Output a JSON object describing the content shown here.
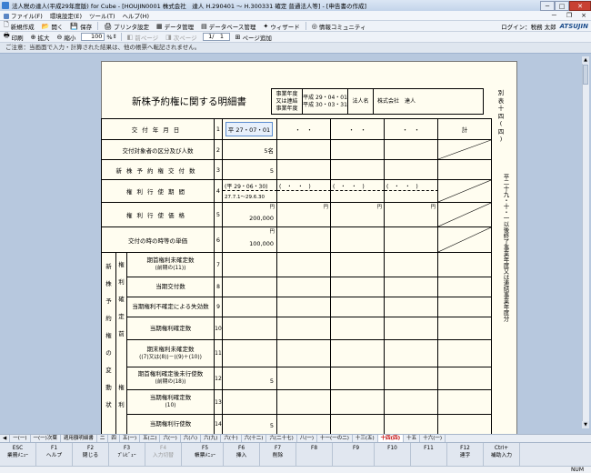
{
  "window": {
    "title": "法人税の達人(平成29年度版) for Cube - [HOUJIN0001 株式会社　達人 H.290401 ～ H.300331 確定 普通法人等] - [申告書の作成]",
    "min_label": "─",
    "max_label": "□",
    "close_label": "✕"
  },
  "menu": {
    "items": [
      "ファイル(F)",
      "環境設定(E)",
      "ツール(T)",
      "ヘルプ(H)"
    ],
    "sub_min": "－",
    "sub_restore": "❐",
    "sub_close": "×"
  },
  "toolbar1": {
    "new": "新規作成",
    "open": "開く",
    "save": "保存",
    "printer": "プリンタ設定",
    "data": "データ管理",
    "db": "データベース管理",
    "wizard": "ウィザード",
    "community": "情報コミュニティ",
    "login": "ログイン：税務 太郎",
    "logo": "ATSUJIN"
  },
  "toolbar2": {
    "print": "印刷",
    "zoom_in": "拡大",
    "zoom_out": "縮小",
    "zoom": "100",
    "zoom_unit": "%",
    "prev_page": "前ページ",
    "next_page": "次ページ",
    "page": "1/　1",
    "add_page": "ページ追加"
  },
  "caution": "ご注意：当画面で入力・計算された結果は、他の帳票へ転記されません。",
  "form": {
    "title": "新株予約権に関する明細書",
    "hdr_year_label": [
      "事業年度",
      "又は連結",
      "事業年度"
    ],
    "hdr_from": "平成 29・04・01",
    "hdr_to": "平成 30・03・31",
    "hdr_corp_label": "法人名",
    "hdr_corp_name": "株式会社　達人",
    "side_top": [
      "別",
      "表",
      "十",
      "四",
      "(",
      "四",
      ")"
    ],
    "side_note": "平二十九・十・一以後終了事業年度又は連結事業年度分",
    "total_label": "計",
    "date_placeholder": "・　・",
    "rows": {
      "date_label": "交付年月日",
      "date_val": "平 27・07・01",
      "category_label": "交付対象者の区分及び人数",
      "category_val": "5名",
      "count_label": "新株予約権交付数",
      "count_val": "5",
      "period_label": "権利行使期間",
      "period_val": "(平 29・06・30)",
      "period_sub": "27.7.1～29.6.30",
      "period_empty": "(　・　・　)",
      "price_label": "権利行使価格",
      "price_val": "200,000",
      "price_unit": "円",
      "unit_value_label": "交付の時の時等の単価",
      "unit_value_val": "100,000"
    },
    "group_label": [
      "新",
      "株",
      "予",
      "約",
      "権",
      "の",
      "変",
      "動",
      "状"
    ],
    "sub_group_label": [
      "権",
      "利",
      "確",
      "定",
      "前",
      "権",
      "利"
    ],
    "sub_rows": [
      {
        "label": "期首権利未確定数",
        "label2": "(前期の(11))",
        "num": "7",
        "val": ""
      },
      {
        "label": "当期交付数",
        "label2": "",
        "num": "8",
        "val": ""
      },
      {
        "label": "当期権利不確定による失効数",
        "label2": "",
        "num": "9",
        "val": ""
      },
      {
        "label": "当期権利確定数",
        "label2": "",
        "num": "10",
        "val": ""
      },
      {
        "label": "期末権利未確定数",
        "label2": "((7)又は(8))－((9)＋(10))",
        "num": "11",
        "val": ""
      },
      {
        "label": "期首権利確定後未行使数",
        "label2": "(前期の(18))",
        "num": "12",
        "val": "5"
      },
      {
        "label": "当期権利確定数",
        "label2": "(10)",
        "num": "13",
        "val": ""
      },
      {
        "label": "当期権利行使数",
        "label2": "",
        "num": "14",
        "val": "5"
      }
    ],
    "row_nums": [
      "1",
      "2",
      "3",
      "4",
      "5",
      "6"
    ]
  },
  "tabs": [
    "一(一)",
    "一(一)次葉",
    "適用額明細書",
    "二",
    "四",
    "五(一)",
    "五(二)",
    "六(一)",
    "六(八)",
    "六(九)",
    "六(十)",
    "六(十二)",
    "六(二十七)",
    "八(一)",
    "十一(一の二)",
    "十三(五)",
    "十四(四)",
    "十五",
    "十六(一)"
  ],
  "active_tab": "十四(四)",
  "fkeys": [
    {
      "key": "ESC",
      "label": "業務ﾒﾆｭｰ"
    },
    {
      "key": "F1",
      "label": "ヘルプ"
    },
    {
      "key": "F2",
      "label": "閉じる"
    },
    {
      "key": "F3",
      "label": "ﾌﾟﾚﾋﾞｭｰ"
    },
    {
      "key": "F4",
      "label": "入力切替"
    },
    {
      "key": "F5",
      "label": "帳票ﾒﾆｭｰ"
    },
    {
      "key": "F6",
      "label": "挿入"
    },
    {
      "key": "F7",
      "label": "削除"
    },
    {
      "key": "F8",
      "label": ""
    },
    {
      "key": "F9",
      "label": ""
    },
    {
      "key": "F10",
      "label": ""
    },
    {
      "key": "F11",
      "label": ""
    },
    {
      "key": "F12",
      "label": "連字"
    },
    {
      "key": "Ctrl+",
      "label": "補助入力"
    }
  ],
  "status": "NUM"
}
